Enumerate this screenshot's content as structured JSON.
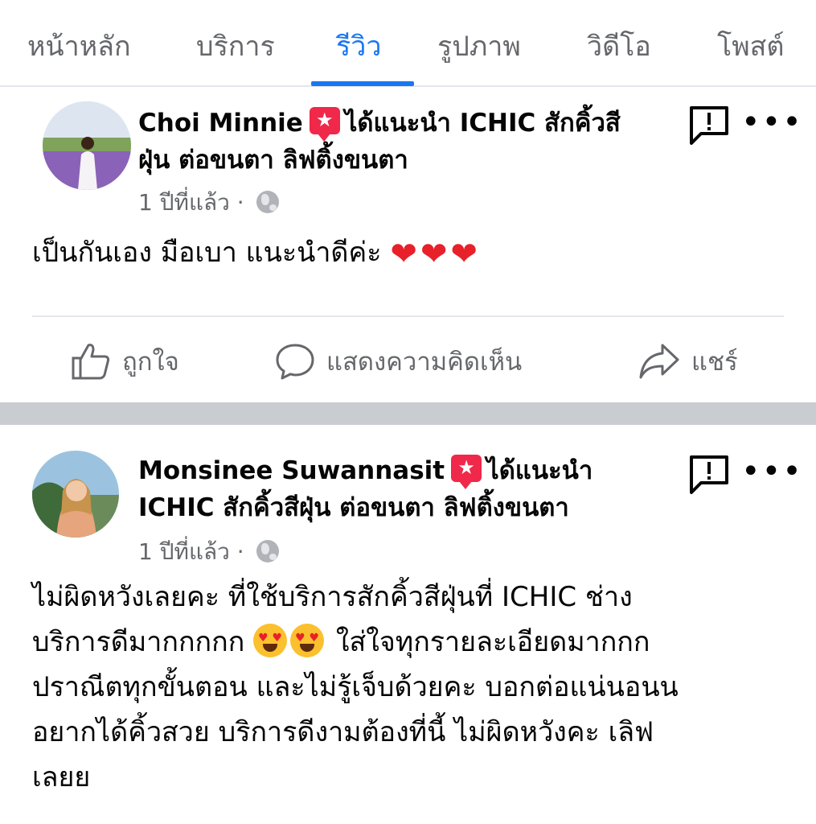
{
  "tabs": [
    {
      "label": "หน้าหลัก",
      "active": false
    },
    {
      "label": "บริการ",
      "active": false
    },
    {
      "label": "รีวิว",
      "active": true
    },
    {
      "label": "รูปภาพ",
      "active": false
    },
    {
      "label": "วิดีโอ",
      "active": false
    },
    {
      "label": "โพสต์",
      "active": false
    }
  ],
  "posts": [
    {
      "author": "Choi Minnie",
      "recommend_line1": "ได้แนะนำ ICHIC สักคิ้วสี",
      "recommend_line2": "ฝุ่น ต่อขนตา ลิฟติ้งขนตา",
      "time": "1 ปีที่แล้ว",
      "separator": "·",
      "text": "เป็นกันเอง มือเบา แนะนำดีค่ะ",
      "hearts": "❤❤❤",
      "actions": {
        "like": "ถูกใจ",
        "comment": "แสดงความคิดเห็น",
        "share": "แชร์"
      }
    },
    {
      "author": "Monsinee Suwannasit",
      "recommend_line1": "ได้แนะนำ",
      "recommend_line2": "ICHIC สักคิ้วสีฝุ่น ต่อขนตา ลิฟติ้งขนตา",
      "time": "1 ปีที่แล้ว",
      "separator": "·",
      "text_lines": [
        "ไม่ผิดหวังเลยคะ ที่ใช้บริการสักคิ้วสีฝุ่นที่ ICHIC ช่าง",
        "บริการดีมากกกกก",
        "ใส่ใจทุกรายละเอียดมากกก",
        "ปราณีตทุกขั้นตอน และไม่รู้เจ็บด้วยคะ บอกต่อแน่นอนน",
        "อยากได้คิ้วสวย บริการดีงามต้องที่นี้ ไม่ผิดหวังคะ เลิฟ",
        "เลยย"
      ]
    }
  ],
  "colors": {
    "accent": "#1877f2",
    "recommend": "#f02849",
    "secondary_text": "#65676b"
  }
}
